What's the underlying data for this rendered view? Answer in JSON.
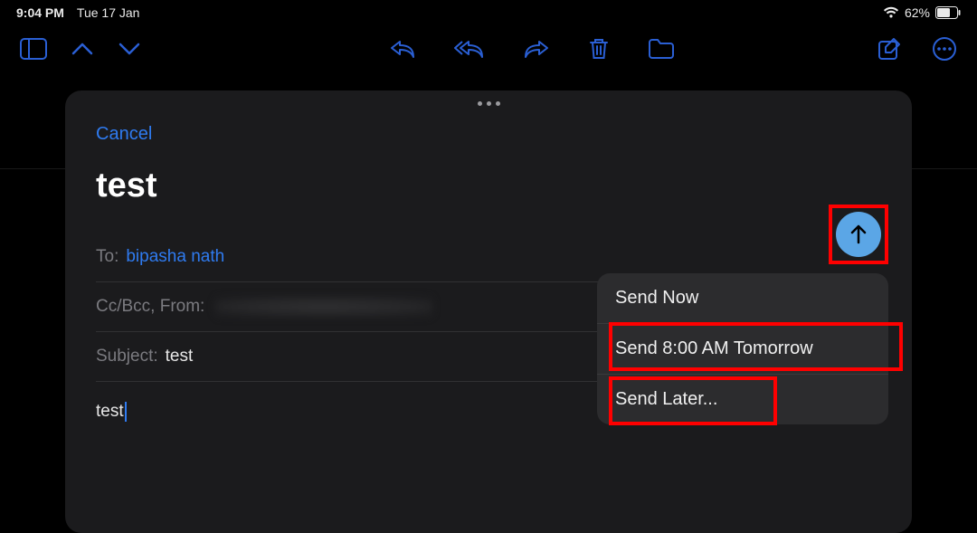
{
  "status": {
    "time": "9:04 PM",
    "date": "Tue 17 Jan",
    "battery": "62%"
  },
  "toolbar": {
    "sidebar": "sidebar",
    "up": "up",
    "down": "down",
    "reply": "reply",
    "reply_all": "reply-all",
    "forward": "forward",
    "trash": "trash",
    "archive": "archive",
    "compose": "compose",
    "more": "more"
  },
  "compose": {
    "cancel": "Cancel",
    "title": "test",
    "to_label": "To:",
    "to_value": "bipasha nath",
    "ccbcc_from_label": "Cc/Bcc, From:",
    "subject_label": "Subject:",
    "subject_value": "test",
    "body": "test"
  },
  "send_menu": {
    "now": "Send Now",
    "tomorrow": "Send 8:00 AM Tomorrow",
    "later": "Send Later..."
  }
}
